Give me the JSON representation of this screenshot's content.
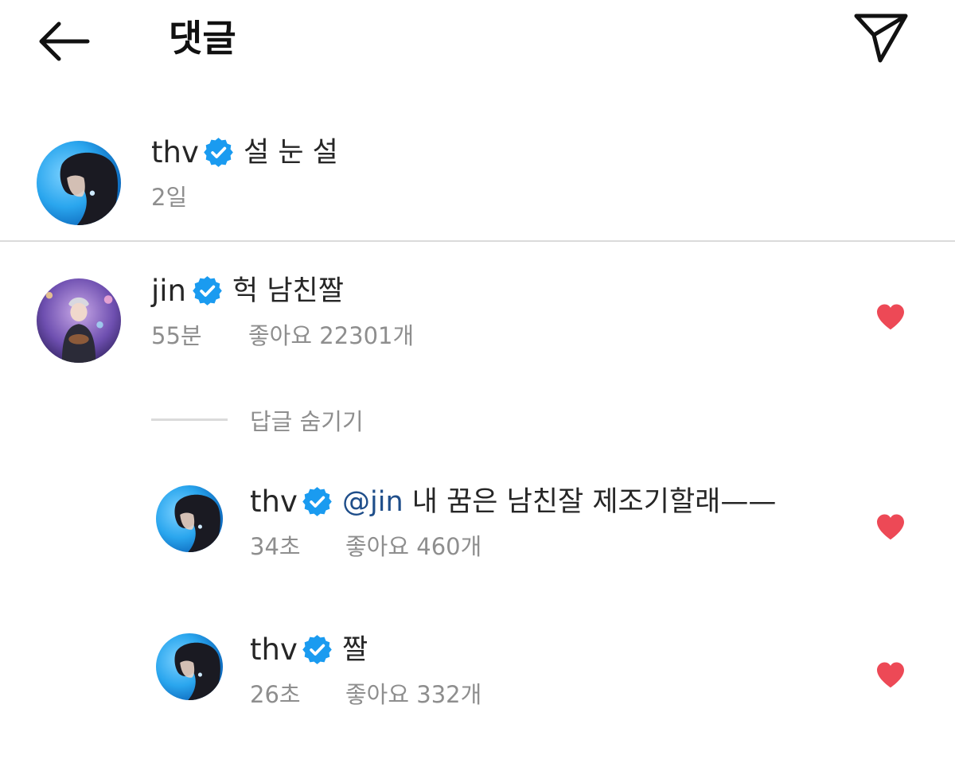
{
  "header": {
    "title": "댓글",
    "back_icon": "arrow-left-icon",
    "share_icon": "paper-plane-icon"
  },
  "caption": {
    "username": "thv",
    "text": "설 눈 설",
    "time": "2일"
  },
  "comments": [
    {
      "username": "jin",
      "text": "헉 남친짤",
      "time": "55분",
      "likes": "좋아요 22301개",
      "liked": true
    }
  ],
  "hide_replies": "답글 숨기기",
  "replies": [
    {
      "username": "thv",
      "mention": "@jin",
      "text": "내 꿈은 남친잘 제조기할래——",
      "time": "34초",
      "likes": "좋아요 460개",
      "liked": true
    },
    {
      "username": "thv",
      "text": "짤",
      "time": "26초",
      "likes": "좋아요 332개",
      "liked": true
    }
  ],
  "colors": {
    "verified": "#1a9bf0",
    "heart": "#ed4956",
    "meta": "#8e8e8e",
    "mention": "#1f4e8a"
  }
}
